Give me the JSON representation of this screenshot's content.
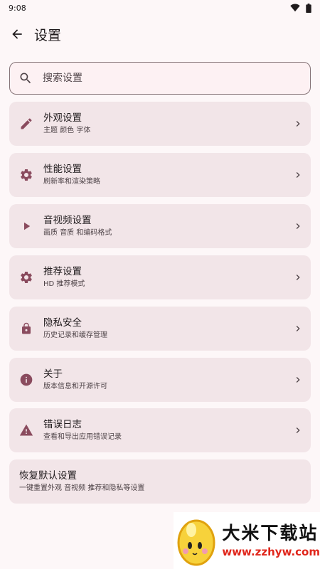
{
  "status_bar": {
    "time": "9:08"
  },
  "app_bar": {
    "title": "设置"
  },
  "search": {
    "placeholder": "搜索设置"
  },
  "items": [
    {
      "icon": "pencil-icon",
      "title": "外观设置",
      "subtitle": "主题 颜色 字体"
    },
    {
      "icon": "gear-icon",
      "title": "性能设置",
      "subtitle": "刷新率和渲染策略"
    },
    {
      "icon": "play-icon",
      "title": "音视频设置",
      "subtitle": "画质 音质 和编码格式"
    },
    {
      "icon": "gear-icon",
      "title": "推荐设置",
      "subtitle": "HD 推荐模式"
    },
    {
      "icon": "lock-icon",
      "title": "隐私安全",
      "subtitle": "历史记录和缓存管理"
    },
    {
      "icon": "info-icon",
      "title": "关于",
      "subtitle": "版本信息和开源许可"
    },
    {
      "icon": "warning-icon",
      "title": "错误日志",
      "subtitle": "查看和导出应用错误记录"
    }
  ],
  "reset": {
    "title": "恢复默认设置",
    "subtitle": "一键重置外观 音视频 推荐和隐私等设置"
  },
  "watermark": {
    "name": "大米下载站",
    "url": "www.zzhyw.com"
  },
  "colors": {
    "accent": "#8a4b5e",
    "card": "#f2e5e8",
    "background": "#fdf7f8"
  }
}
